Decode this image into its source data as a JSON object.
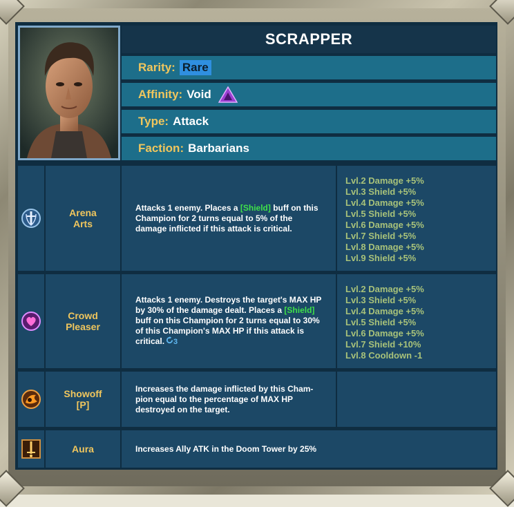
{
  "champion": {
    "name": "SCRAPPER",
    "rarity_label": "Rarity:",
    "rarity": "Rare",
    "affinity_label": "Affinity:",
    "affinity": "Void",
    "type_label": "Type:",
    "type": "Attack",
    "faction_label": "Faction:",
    "faction": "Barbarians"
  },
  "skills": [
    {
      "name_line1": "Arena",
      "name_line2": "Arts",
      "desc_pre": "Attacks 1 enemy. Places a ",
      "desc_tag": "[Shield]",
      "desc_post": " buff on this Champion for 2 turns equal to 5% of the damage inflicted if this attack is critical.",
      "books": [
        "Lvl.2 Damage +5%",
        "Lvl.3 Shield +5%",
        "Lvl.4 Damage +5%",
        "Lvl.5 Shield +5%",
        "Lvl.6 Damage +5%",
        "Lvl.7 Shield +5%",
        "Lvl.8 Damage +5%",
        "Lvl.9 Shield +5%"
      ]
    },
    {
      "name_line1": "Crowd",
      "name_line2": "Pleaser",
      "desc_pre": "Attacks 1 enemy. Destroys the target's MAX HP by 30% of the damage dealt. Places a ",
      "desc_tag": "[Shield]",
      "desc_post": " buff on this Champion for 2 turns equal to 30% of this Champion's MAX HP if this attack is critical.",
      "cooldown": "3",
      "books": [
        "Lvl.2 Damage +5%",
        "Lvl.3 Shield +5%",
        "Lvl.4 Damage +5%",
        "Lvl.5 Shield +5%",
        "Lvl.6 Damage +5%",
        "Lvl.7 Shield +10%",
        "Lvl.8 Cooldown -1"
      ]
    },
    {
      "name_line1": "Showoff",
      "name_line2": "[P]",
      "desc": "Increases the damage inflicted by this Cham-pion equal to the percentage of MAX HP destroyed on the target."
    },
    {
      "name_line1": "Aura",
      "desc": "Increases Ally ATK in the Doom Tower by 25%"
    }
  ],
  "colors": {
    "gold": "#f0c65d",
    "green_book": "#a8c27a",
    "shield_green": "#3fe04a",
    "void": "#9b3fd1"
  }
}
